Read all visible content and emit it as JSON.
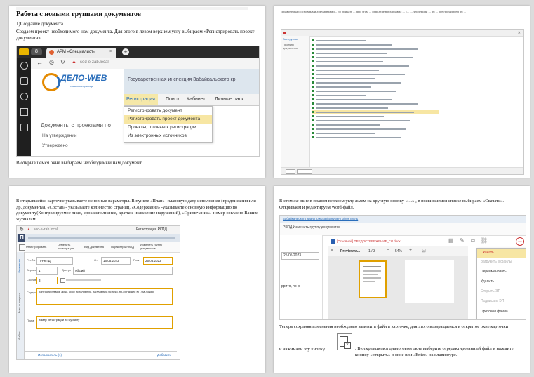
{
  "p1": {
    "top_faint": "",
    "heading": "Работа с новыми группами документов",
    "step": "1)Создание документа.",
    "para": "Создаем проект необходимого нам документа. Для этого в левом верхнем углу выбираем «Регистрировать проект документа»",
    "browser": {
      "tab_title": "АРМ «Специалист»",
      "url": "sed-e-zab.local"
    },
    "app": {
      "logo": "ДЕЛО-WEB",
      "logo_sub": "главная страница",
      "org": "Государственная инспекция Забайкальского кр",
      "nav": [
        "Регистрация",
        "Поиск",
        "Кабинет",
        "Личные папк"
      ],
      "dropdown": [
        "Регистрировать документ",
        "Регистрировать проект документа",
        "Проекты, готовые к регистрации",
        "Из электронных источников"
      ],
      "section": "Документы с проектами по",
      "list": [
        "На утверждении",
        "Утверждено"
      ]
    },
    "footer": "В открывшемся окне выбираем необходимый нам документ"
  },
  "p2": {
    "para": "справочника с основными документами... по приказу ... при этом ... определенных правил ... с... ...Инспекции ... 36 ... реестр записей 36 ...",
    "win_left": [
      "Все группы",
      "Проекты документов"
    ],
    "list_count": 24,
    "highlight_index": 17
  },
  "p3": {
    "para": "В открывшейся карточке указываете основные параметры. В пункте «План» -плановую дату исполнения (предписания или др. документа), «Состав»- указываете количество страниц, «Содержание» -указываете основную информацию по документу(Контролируемое лицо, срок исполнения, краткое изложение нарушений), «Примечание»- номер согласно Вашим журналам.",
    "url": "sed-e-zab.local",
    "win_title": "Регистрация РКПД",
    "toolbar": [
      "Регистрировать",
      "Отменить регистрацию",
      "Вид документа",
      "Параметры РКПД",
      "Изменить группу документов"
    ],
    "side_tabs": [
      "Реквизиты",
      "Визы и подписи",
      "Файлы"
    ],
    "fields": {
      "reg_no_label": "Рег. №",
      "reg_no": "П-РКПД",
      "date_label": "От",
      "date": "16.05.2023",
      "plan_label": "План",
      "plan_date": "25.05.2023",
      "version_label": "Версия",
      "version": "1",
      "access_label": "Доступ",
      "access": "общий",
      "sostav_label": "Состав",
      "sostav": "3",
      "content_label": "Содерж.",
      "content": "Контролируемое лицо, срок исполнения, нарушения (Кратко, пр-р) Раздел КП / М.Ложер",
      "note_label": "Прим.",
      "note": "номер регистрации по журналу",
      "performers": "Исполнитель (1)",
      "add": "Добавить"
    }
  },
  "p4": {
    "para": "В этом же окне в правом верхнем углу жмем на круглую кнопку «…» , в появившемся списке выбираем «Скачать». Открываем и редактируем Word-файл.",
    "link_bar": "Забайкальского края/Приказы/документы/контроль",
    "group_btn": "РКПД  Изменить группу документов",
    "doc_name": "[Основной] ПРЕДОСТЕРЕЖЕНИЕ_ГИ.docx",
    "date": "25.05.2023",
    "preview_label": "Preview.w...",
    "pages": "1 / 3",
    "zoom": "54%",
    "side_text": "ррито, пр-р",
    "menu": [
      "Скачать",
      "Загрузить в файлы",
      "Переименовать",
      "Удалить",
      "Открыть ЭП",
      "Подписать ЭП",
      "Протокол файла"
    ],
    "para2": "Теперь сохраняя изменения необходимо заменить файл в карточке, для этого возвращаемся в открытое окне карточки",
    "para3_a": "и нажимаем эту  кнопку",
    "para3_b": ". В открывшемся диалоговом окне выберите отредактированный файл и нажмите кнопку «открыть» в окне или «Enter» на клавиатуре."
  }
}
